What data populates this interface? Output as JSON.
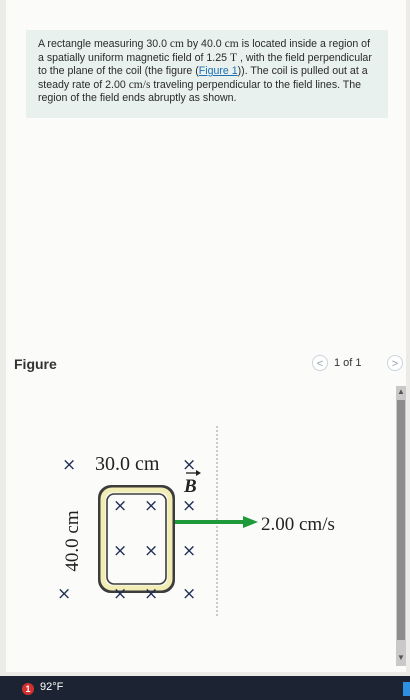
{
  "problem": {
    "text_1": "A rectangle measuring 30.0 ",
    "unit_cm_1": "cm",
    "text_2": " by 40.0 ",
    "unit_cm_2": "cm",
    "text_3": " is located inside a region of a spatially uniform magnetic field of 1.25 ",
    "unit_T": "T",
    "text_4": " , with the field perpendicular to the plane of the coil (the figure (",
    "figure_link": "Figure 1",
    "text_5": ")). The coil is pulled out at a steady rate of 2.00 ",
    "unit_speed": "cm/s",
    "text_6": " traveling perpendicular to the field lines. The region of the field ends abruptly as shown."
  },
  "figure_panel": {
    "title": "Figure",
    "pager": "1 of 1",
    "prev_glyph": "<",
    "next_glyph": ">"
  },
  "figure": {
    "width_label": "30.0 cm",
    "height_label": "40.0 cm",
    "field_label": "B",
    "velocity_label": "2.00 cm/s",
    "field_glyph": "×",
    "colors": {
      "coil_outer": "#3c3c3c",
      "coil_inner": "#f2ecb5",
      "arrow": "#1f9a3a",
      "field_x": "#1f2e55",
      "boundary": "#a9a9a9"
    }
  },
  "scrollbar": {
    "up_glyph": "▲",
    "down_glyph": "▼"
  },
  "taskbar": {
    "badge": "1",
    "weather": "92°F"
  }
}
